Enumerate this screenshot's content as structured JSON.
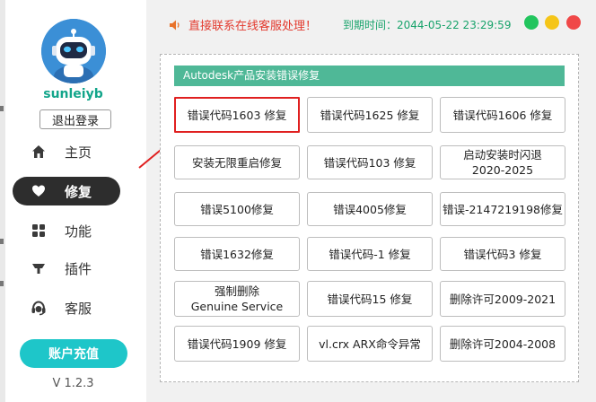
{
  "user": {
    "name": "sunleiyb",
    "logout_label": "退出登录"
  },
  "nav": [
    {
      "id": "home",
      "label": "主页",
      "icon": "home-icon",
      "active": false
    },
    {
      "id": "repair",
      "label": "修复",
      "icon": "heart-icon",
      "active": true
    },
    {
      "id": "features",
      "label": "功能",
      "icon": "grid-icon",
      "active": false
    },
    {
      "id": "plugins",
      "label": "插件",
      "icon": "plugin-icon",
      "active": false
    },
    {
      "id": "support",
      "label": "客服",
      "icon": "headset-icon",
      "active": false
    }
  ],
  "recharge_label": "账户充值",
  "version": "V 1.2.3",
  "topbar": {
    "notice": "直接联系在线客服处理！",
    "expire": "到期时间：2044-05-22 23:29:59",
    "window_dots": [
      "#22c55e",
      "#f5c518",
      "#f04848"
    ]
  },
  "panel": {
    "title": "Autodesk产品安装错误修复",
    "buttons": [
      [
        "错误代码1603 修复"
      ],
      [
        "错误代码1625 修复"
      ],
      [
        "错误代码1606 修复"
      ],
      [
        "安装无限重启修复"
      ],
      [
        "错误代码103 修复"
      ],
      [
        "启动安装时闪退",
        "2020-2025"
      ],
      [
        "错误5100修复"
      ],
      [
        "错误4005修复"
      ],
      [
        "错误-2147219198修复"
      ],
      [
        "错误1632修复"
      ],
      [
        "错误代码-1 修复"
      ],
      [
        "错误代码3 修复"
      ],
      [
        "强制删除",
        "Genuine Service"
      ],
      [
        "错误代码15 修复"
      ],
      [
        "删除许可2009-2021"
      ],
      [
        "错误代码1909 修复"
      ],
      [
        "vl.crx ARX命令异常"
      ],
      [
        "删除许可2004-2008"
      ]
    ],
    "highlighted_index": 0
  },
  "colors": {
    "accent": "#1ec6c9",
    "title_bar": "#4fb897",
    "highlight": "#e02020"
  }
}
